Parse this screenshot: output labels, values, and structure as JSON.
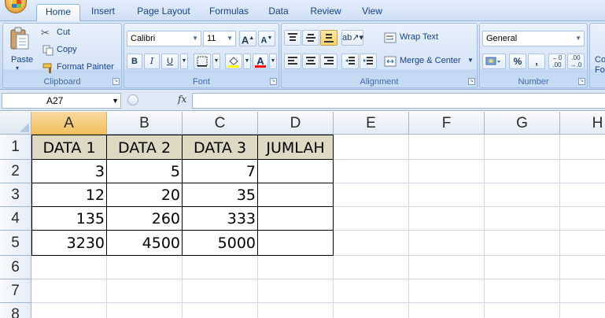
{
  "ribbon_tabs": [
    "Home",
    "Insert",
    "Page Layout",
    "Formulas",
    "Data",
    "Review",
    "View"
  ],
  "clipboard": {
    "paste_label": "Paste",
    "cut_label": "Cut",
    "copy_label": "Copy",
    "format_painter_label": "Format Painter",
    "group_label": "Clipboard"
  },
  "font": {
    "font_name": "Calibri",
    "font_size": "11",
    "bold": "B",
    "italic": "I",
    "underline": "U",
    "grow": "A",
    "shrink": "A",
    "color_letter": "A",
    "group_label": "Font",
    "font_color": "#ff0000"
  },
  "alignment": {
    "wrap_text_label": "Wrap Text",
    "merge_center_label": "Merge & Center",
    "group_label": "Alignment"
  },
  "number": {
    "format": "General",
    "percent": "%",
    "comma": ",",
    "group_label": "Number"
  },
  "styles": {
    "conditional_formatting_label": "Co",
    "format_label": "Fo"
  },
  "formula_bar": {
    "name_box": "A27",
    "fx": "fx",
    "formula": ""
  },
  "sheet": {
    "columns": [
      "A",
      "B",
      "C",
      "D",
      "E",
      "F",
      "G",
      "H"
    ],
    "selected_column": "A",
    "rows": [
      "1",
      "2",
      "3",
      "4",
      "5",
      "6",
      "7",
      "8"
    ],
    "table": {
      "headers": [
        "DATA 1",
        "DATA 2",
        "DATA 3",
        "JUMLAH"
      ],
      "rows": [
        [
          "3",
          "5",
          "7",
          ""
        ],
        [
          "12",
          "20",
          "35",
          ""
        ],
        [
          "135",
          "260",
          "333",
          ""
        ],
        [
          "3230",
          "4500",
          "5000",
          ""
        ]
      ]
    }
  },
  "colors": {
    "header_fill": "#ddd9c3",
    "selected_column_header": "#f1c15f",
    "ribbon_text": "#15428b"
  }
}
